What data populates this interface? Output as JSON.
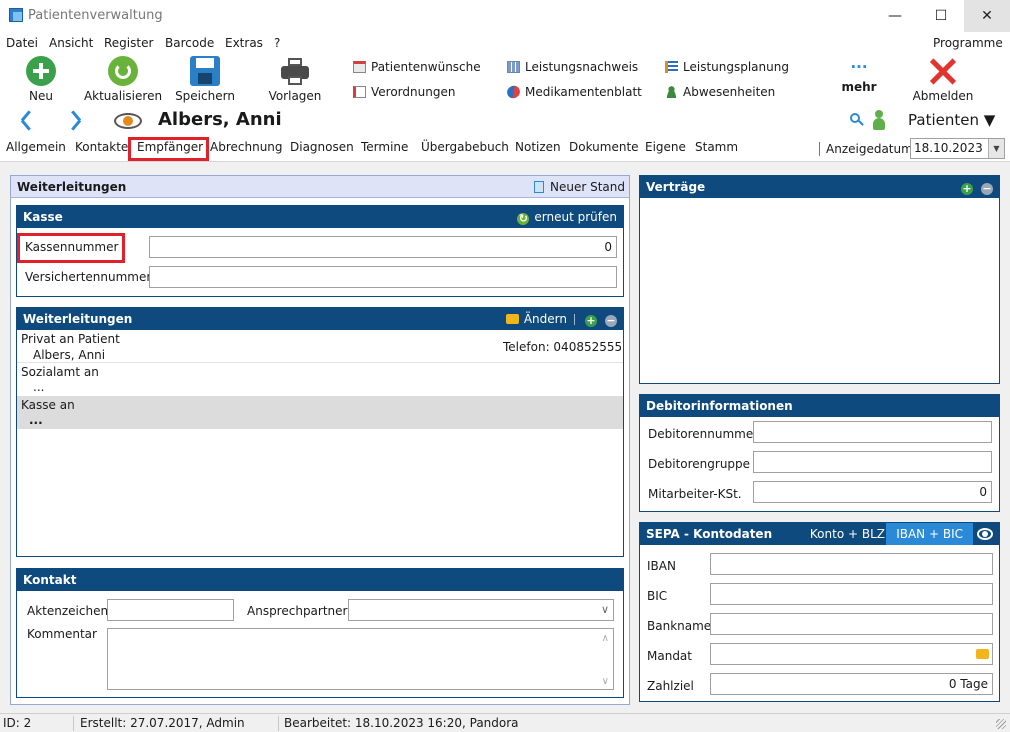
{
  "window": {
    "title": "Patientenverwaltung",
    "minimize": "—",
    "maximize": "☐",
    "close": "✕"
  },
  "menu": {
    "items": [
      "Datei",
      "Ansicht",
      "Register",
      "Barcode",
      "Extras",
      "?"
    ],
    "right": "Programme"
  },
  "toolbar": {
    "neu": "Neu",
    "aktualisieren": "Aktualisieren",
    "speichern": "Speichern",
    "vorlagen": "Vorlagen",
    "patientenwuensche": "Patientenwünsche",
    "verordnungen": "Verordnungen",
    "leistungsnachweis": "Leistungsnachweis",
    "medikamentenblatt": "Medikamentenblatt",
    "leistungsplanung": "Leistungsplanung",
    "abwesenheiten": "Abwesenheiten",
    "mehr_dots": "···",
    "mehr": "mehr",
    "abmelden": "Abmelden"
  },
  "nav": {
    "patient_name": "Albers, Anni",
    "patienten": "Patienten"
  },
  "tabs": [
    "Allgemein",
    "Kontakte",
    "Empfänger",
    "Abrechnung",
    "Diagnosen",
    "Termine",
    "Übergabebuch",
    "Notizen",
    "Dokumente",
    "Eigene",
    "Stamm"
  ],
  "active_tab": "Empfänger",
  "anzeigedatum": {
    "label": "Anzeigedatum",
    "value": "18.10.2023"
  },
  "weiterleitungen_outer": {
    "title": "Weiterleitungen",
    "neuer_stand": "Neuer Stand"
  },
  "kasse": {
    "title": "Kasse",
    "erneut_pruefen": "erneut prüfen",
    "kassennummer_label": "Kassennummer",
    "kassennummer_value": "0",
    "versichertennummer_label": "Versichertennummer",
    "versichertennummer_value": ""
  },
  "weiterleitungen": {
    "title": "Weiterleitungen",
    "aendern": "Ändern",
    "rows": [
      {
        "label": "Privat an Patient",
        "value": "Albers, Anni",
        "extra": "Telefon: 040852555"
      },
      {
        "label": "Sozialamt an",
        "value": "...",
        "extra": ""
      },
      {
        "label": "Kasse an",
        "value": "...",
        "extra": ""
      }
    ]
  },
  "kontakt": {
    "title": "Kontakt",
    "aktenzeichen_label": "Aktenzeichen",
    "ansprechpartner_label": "Ansprechpartner",
    "kommentar_label": "Kommentar"
  },
  "vertraege": {
    "title": "Verträge"
  },
  "debitor": {
    "title": "Debitorinformationen",
    "debitorennummer_label": "Debitorennummer",
    "debitorengruppe_label": "Debitorengruppe",
    "mitarbeiter_label": "Mitarbeiter-KSt.",
    "mitarbeiter_value": "0"
  },
  "sepa": {
    "title": "SEPA - Kontodaten",
    "konto_blz": "Konto + BLZ",
    "iban_bic": "IBAN + BIC",
    "iban_label": "IBAN",
    "bic_label": "BIC",
    "bankname_label": "Bankname",
    "mandat_label": "Mandat",
    "zahlziel_label": "Zahlziel",
    "zahlziel_value": "0 Tage"
  },
  "status": {
    "id": "ID: 2",
    "erstellt": "Erstellt: 27.07.2017, Admin",
    "bearbeitet": "Bearbeitet: 18.10.2023 16:20, Pandora"
  },
  "colors": {
    "header_blue": "#0e4a7d",
    "accent_blue": "#2b8ad8",
    "highlight_red": "#e0202a",
    "add_green": "#3aa14a"
  }
}
